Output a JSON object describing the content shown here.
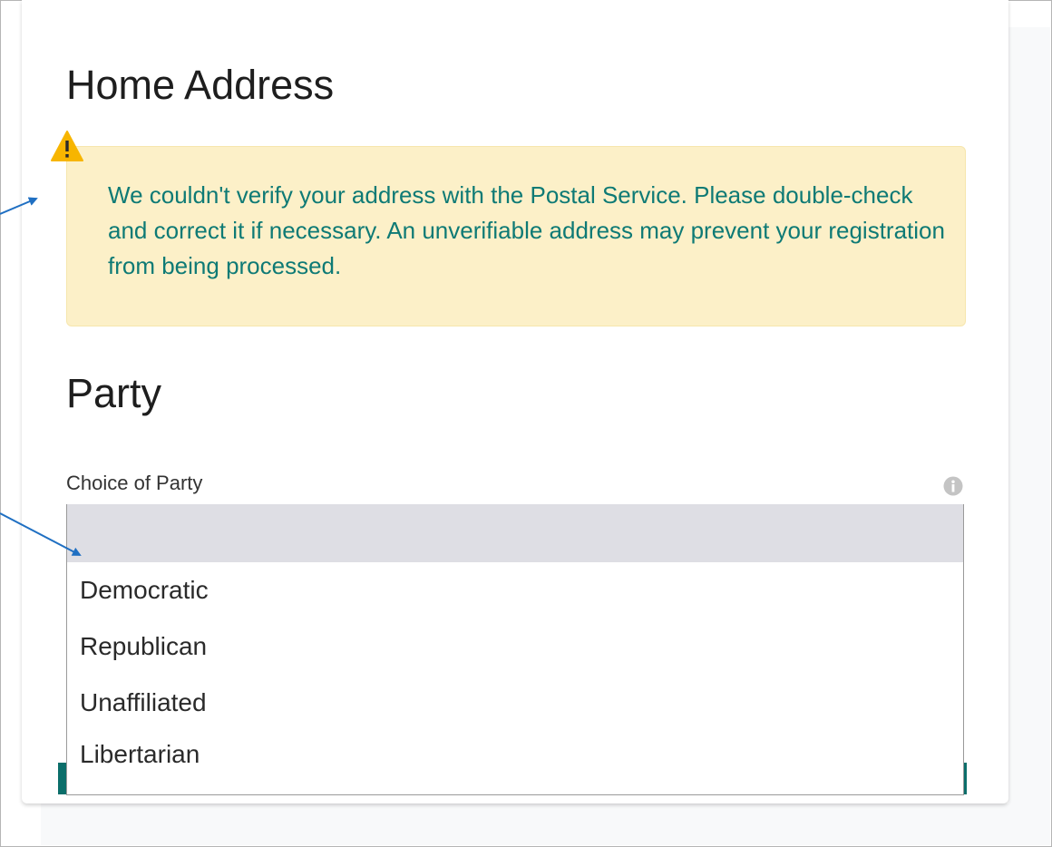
{
  "home_address": {
    "title": "Home Address",
    "warning_icon": "warning-triangle-icon",
    "warning_text": "We couldn't verify your address with the Postal Service. Please double-check and correct it if necessary. An unverifiable address may prevent your registration from being processed."
  },
  "party": {
    "title": "Party",
    "choice_label": "Choice of Party",
    "info_icon": "info-icon",
    "options": [
      {
        "label": ""
      },
      {
        "label": "Democratic"
      },
      {
        "label": "Republican"
      },
      {
        "label": "Unaffiliated"
      },
      {
        "label": "Libertarian"
      }
    ]
  },
  "colors": {
    "warning_background": "#fcf0c8",
    "warning_text": "#0e7a75",
    "warning_icon": "#f7b500",
    "annotation_arrow": "#1f6fc2",
    "teal_button": "#0b6e6a"
  }
}
